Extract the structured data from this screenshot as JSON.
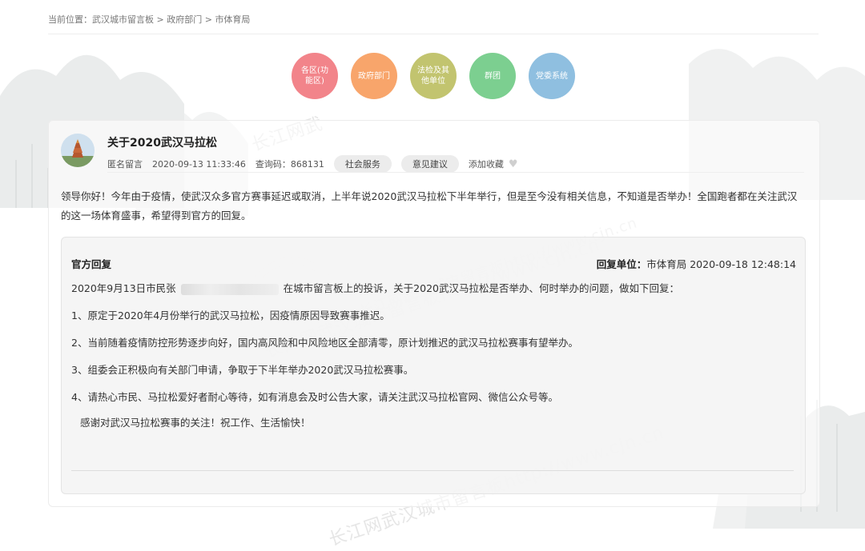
{
  "breadcrumb": {
    "prefix": "当前位置：",
    "items": [
      "武汉城市留言板",
      "政府部门",
      "市体育局"
    ],
    "separator": " > "
  },
  "categories": [
    {
      "label": "各区(功能区)",
      "color": "#f2848a"
    },
    {
      "label": "政府部门",
      "color": "#f8a56b"
    },
    {
      "label": "法检及其他单位",
      "color": "#c2c46f"
    },
    {
      "label": "群团",
      "color": "#7ccf90"
    },
    {
      "label": "党委系统",
      "color": "#8fbfe0"
    }
  ],
  "post": {
    "title": "关于2020武汉马拉松",
    "author": "匿名留言",
    "datetime": "2020-09-13 11:33:46",
    "query_code": "查询码：868131",
    "tags": [
      "社会服务",
      "意见建议"
    ],
    "favorite_label": "添加收藏",
    "body": "领导你好！今年由于疫情，使武汉众多官方赛事延迟或取消，上半年说2020武汉马拉松下半年举行，但是至今没有相关信息，不知道是否举办！全国跑者都在关注武汉的这一场体育盛事，希望得到官方的回复。"
  },
  "reply": {
    "label": "官方回复",
    "unit_label": "回复单位：",
    "unit": "市体育局",
    "datetime": "2020-09-18 12:48:14",
    "intro_before": "2020年9月13日市民张",
    "intro_after": "在城市留言板上的投诉，关于2020武汉马拉松是否举办、何时举办的问题，做如下回复：",
    "points": [
      "1、原定于2020年4月份举行的武汉马拉松，因疫情原因导致赛事推迟。",
      "2、当前随着疫情防控形势逐步向好，国内高风险和中风险地区全部清零，原计划推迟的武汉马拉松赛事有望举办。",
      "3、组委会正积极向有关部门申请，争取于下半年举办2020武汉马拉松赛事。",
      "4、请热心市民、马拉松爱好者耐心等待，如有消息会及时公告大家，请关注武汉马拉松官网、微信公众号等。"
    ],
    "closing": "感谢对武汉马拉松赛事的关注！祝工作、生活愉快！"
  },
  "watermarks": [
    "长江网武汉城市留言板http://www.cjn.cn",
    "长江网武汉城市留言板http://www.cjn.cn",
    "长江网武汉城市留言板http://www.cjn.cn",
    "长江网武"
  ]
}
